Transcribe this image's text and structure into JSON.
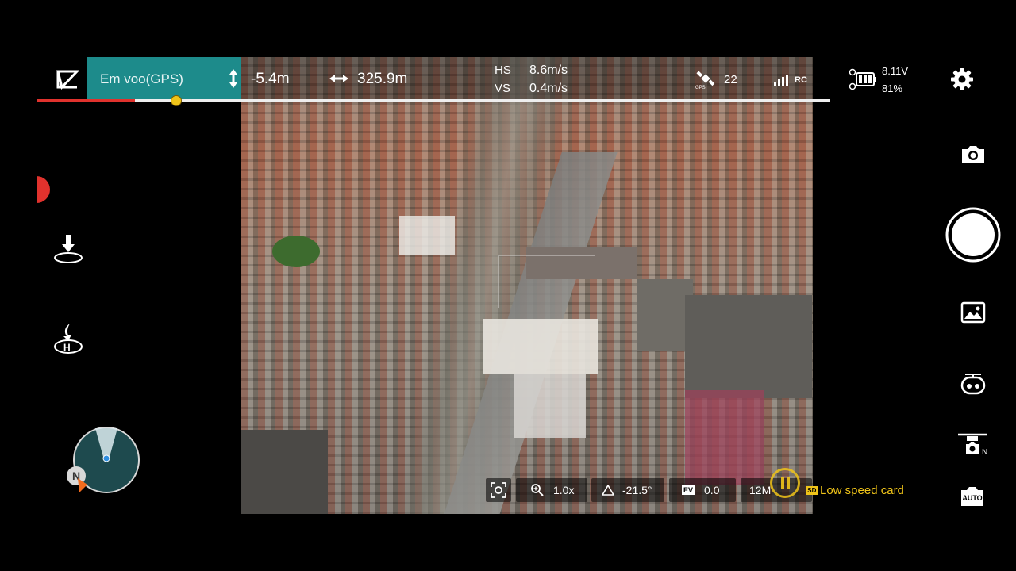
{
  "flight": {
    "mode": "Em voo(GPS)",
    "altitude": "-5.4m",
    "distance": "325.9m",
    "hs_label": "HS",
    "hs_value": "8.6m/s",
    "vs_label": "VS",
    "vs_value": "0.4m/s",
    "gps_count": "22",
    "rc_label": "RC",
    "battery_voltage": "8.11V",
    "battery_percent": "81%"
  },
  "camera": {
    "zoom": "1.0x",
    "gimbal_angle": "-21.5°",
    "ev_label": "EV",
    "ev_value": "0.0",
    "resolution": "12M",
    "sd_label": "SD",
    "storage_warning": "Low speed card"
  },
  "compass": {
    "north_label": "N"
  },
  "right_panel": {
    "auto_label": "AUTO",
    "drone_nav_label": "N"
  },
  "colors": {
    "status_teal": "#1d8b8b",
    "progress_red": "#e0322d",
    "warning_yellow": "#f0c419"
  },
  "icons": {
    "logo": "dji-fly-logo-icon",
    "altitude": "vertical-arrows-icon",
    "distance": "horizontal-arrows-icon",
    "gps": "gps-satellite-icon",
    "signal": "signal-bars-icon",
    "battery": "drone-battery-icon",
    "settings": "gear-icon",
    "takeoff": "auto-takeoff-icon",
    "return_home": "return-to-home-icon",
    "camera": "camera-icon",
    "shutter": "shutter-button-icon",
    "gallery": "gallery-icon",
    "camera_mode": "camera-mode-icon",
    "drone_camera": "drone-camera-icon",
    "auto": "auto-exposure-icon"
  }
}
